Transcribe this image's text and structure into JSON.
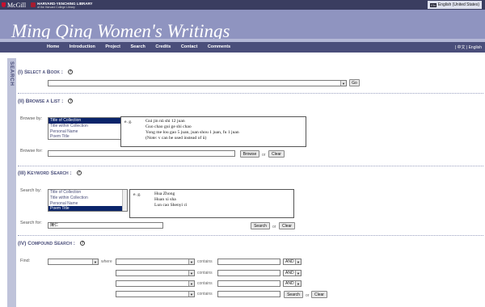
{
  "topbar": {
    "mcgill": "McGill",
    "harvard_line1": "HARVARD-YENCHING LIBRARY",
    "harvard_line2": "of the Harvard College Library",
    "lang_badge": "EN",
    "language": "English (United States)"
  },
  "banner": {
    "title": "Ming Qing Women's Writings"
  },
  "nav": {
    "items": [
      "Home",
      "Introduction",
      "Project",
      "Search",
      "Credits",
      "Contact",
      "Comments"
    ],
    "lang_switch": "| 中文 | English"
  },
  "side_tab": "SEARCH",
  "sections": {
    "select_book": {
      "title": "(I) Select a Book :",
      "go": "Go"
    },
    "browse": {
      "title": "(II) Browse a List :",
      "browse_by_label": "Browse by:",
      "options": [
        "Title of Collection",
        "Title within Collection",
        "Personal Name",
        "Poem Title"
      ],
      "selected": 0,
      "eg": "e. g.",
      "examples": [
        "Gui jin nü shi 12 juan",
        "Guo chao gui ge shi chao",
        "Yong me lou gao 5 juan, juan shou 1 juan, fu 1 juan",
        "(Note: v can be used instead of ü)"
      ],
      "browse_for_label": "Browse for:",
      "browse_btn": "Browse",
      "or": "or",
      "clear_btn": "Clear"
    },
    "keyword": {
      "title": "(III) Keyword Search :",
      "search_by_label": "Search by:",
      "options": [
        "Title of Collection",
        "Title within Collection",
        "Personal Name",
        "Poem Title"
      ],
      "selected": 3,
      "eg": "e. g.",
      "examples": [
        "Hua Zhong",
        "Huan xi sha",
        "Lun cao Shenyi ci"
      ],
      "search_for_label": "Search for:",
      "search_value": "陳仁",
      "search_btn": "Search",
      "or": "or",
      "clear_btn": "Clear"
    },
    "compound": {
      "title": "(IV) Compound Search :",
      "find_label": "Find:",
      "where": "where",
      "contains": "contains",
      "op": "AND",
      "search_btn": "Search",
      "or": "or",
      "clear_btn": "Clear"
    }
  }
}
